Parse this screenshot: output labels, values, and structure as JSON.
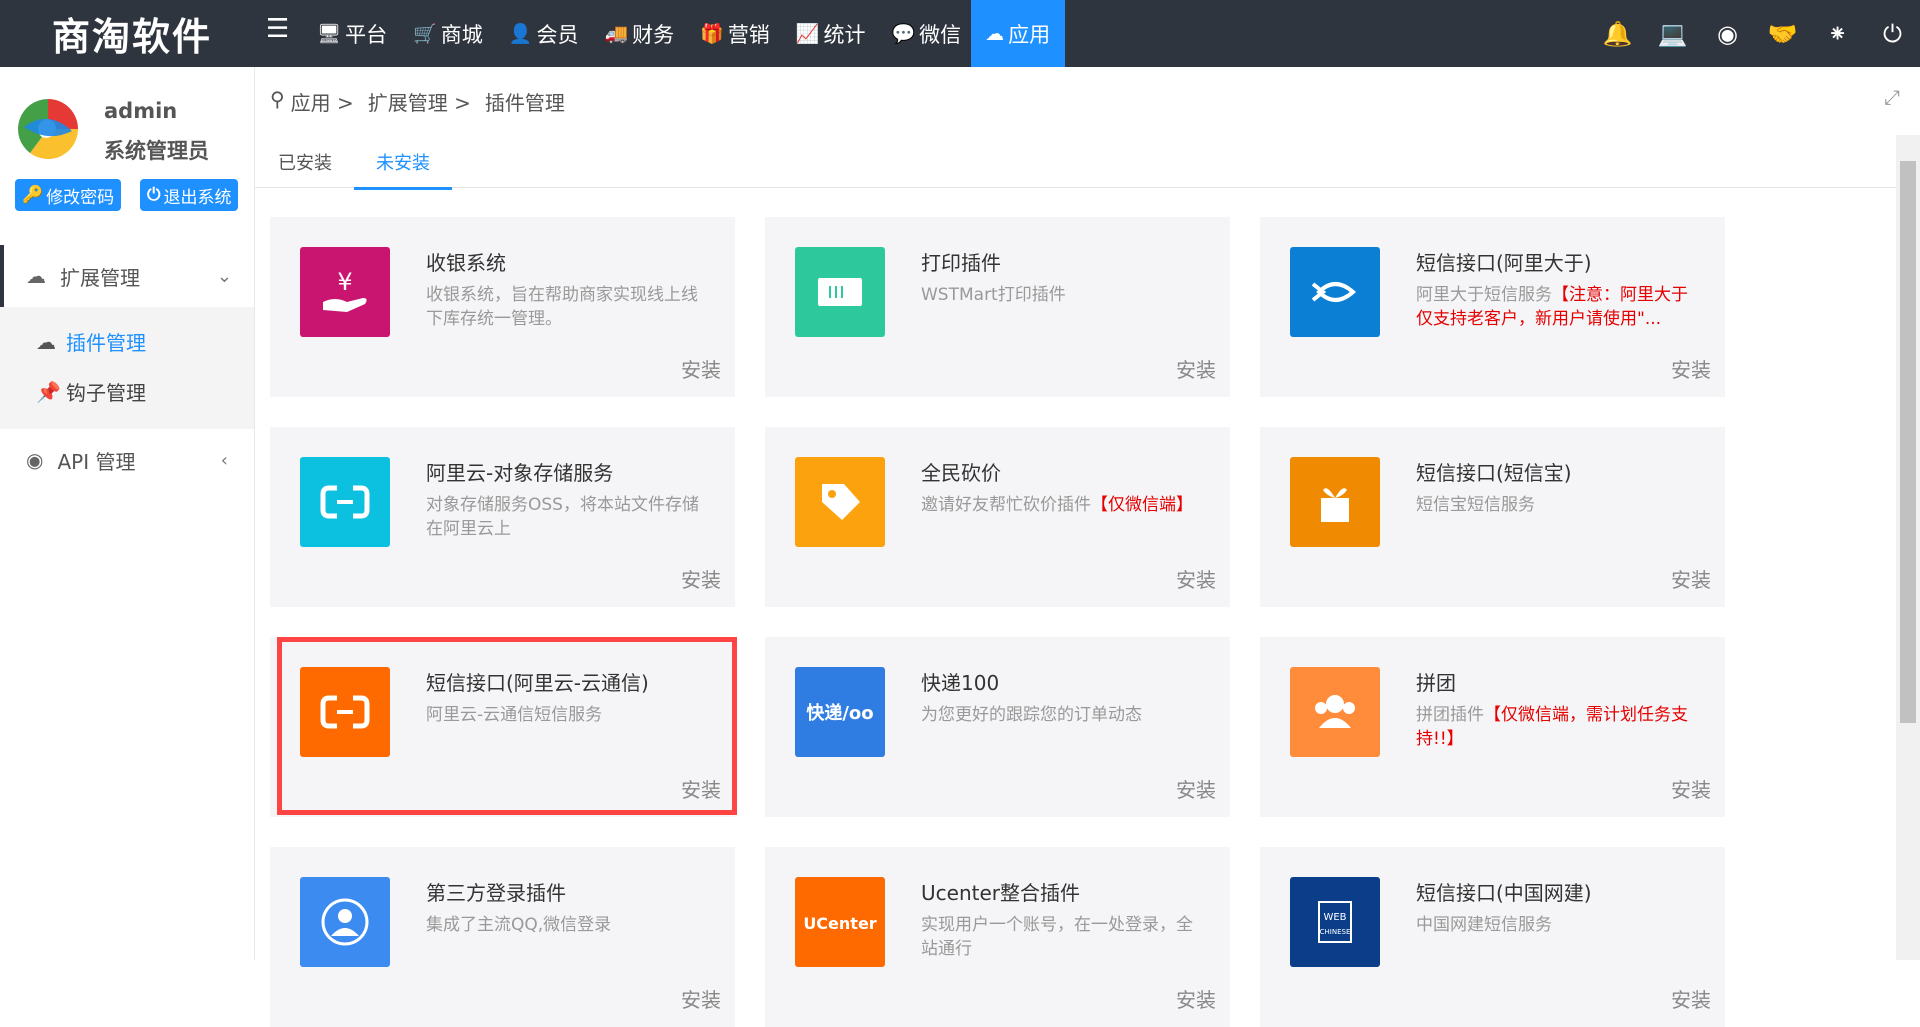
{
  "header": {
    "logo": "商淘软件",
    "nav": [
      {
        "label": "平台",
        "icon": "monitor-icon"
      },
      {
        "label": "商城",
        "icon": "cart-icon"
      },
      {
        "label": "会员",
        "icon": "user-icon"
      },
      {
        "label": "财务",
        "icon": "truck-icon"
      },
      {
        "label": "营销",
        "icon": "gift-icon"
      },
      {
        "label": "统计",
        "icon": "chart-icon"
      },
      {
        "label": "微信",
        "icon": "wechat-icon"
      },
      {
        "label": "应用",
        "icon": "cloud-icon",
        "active": true
      }
    ],
    "icons": [
      "bell-icon",
      "desktop-icon",
      "location-icon",
      "handshake-icon",
      "spinner-icon",
      "power-icon"
    ]
  },
  "user": {
    "name": "admin",
    "role": "系统管理员",
    "change_password": "修改密码",
    "logout": "退出系统"
  },
  "sidebar": {
    "group1": "扩展管理",
    "items": [
      "插件管理",
      "钩子管理"
    ],
    "group2": "API 管理"
  },
  "breadcrumb": [
    "应用 >",
    "扩展管理 >",
    "插件管理"
  ],
  "tabs": [
    "已安装",
    "未安装"
  ],
  "install_label": "安装",
  "plugins": [
    {
      "title": "收银系统",
      "desc": "收银系统，旨在帮助商家实现线上线下库存统一管理。",
      "red": "",
      "color": "#c9156f",
      "icon": "cashier-icon"
    },
    {
      "title": "打印插件",
      "desc": "WSTMart打印插件",
      "red": "",
      "color": "#2dc99c",
      "icon": "printer-icon"
    },
    {
      "title": "短信接口(阿里大于)",
      "desc": "阿里大于短信服务",
      "red": "【注意：阿里大于仅支持老客户，新用户请使用\"...",
      "color": "#0a7fd4",
      "icon": "fish-icon"
    },
    {
      "title": "阿里云-对象存储服务",
      "desc": "对象存储服务OSS，将本站文件存储在阿里云上",
      "red": "",
      "color": "#0cc0e0",
      "icon": "aliyun-icon"
    },
    {
      "title": "全民砍价",
      "desc": "邀请好友帮忙砍价插件",
      "red": "【仅微信端】",
      "color": "#fba20e",
      "icon": "tag-icon"
    },
    {
      "title": "短信接口(短信宝)",
      "desc": "短信宝短信服务",
      "red": "",
      "color": "#f08a00",
      "icon": "box-icon"
    },
    {
      "title": "短信接口(阿里云-云通信)",
      "desc": "阿里云-云通信短信服务",
      "red": "",
      "color": "#ff6a00",
      "icon": "aliyun-icon"
    },
    {
      "title": "快递100",
      "desc": "为您更好的跟踪您的订单动态",
      "red": "",
      "color": "#2f7de2",
      "icon": "kuaidi-icon"
    },
    {
      "title": "拼团",
      "desc": "拼团插件",
      "red": "【仅微信端，需计划任务支持!!】",
      "color": "#ff8c3a",
      "icon": "group-icon"
    },
    {
      "title": "第三方登录插件",
      "desc": "集成了主流QQ,微信登录",
      "red": "",
      "color": "#3b8bf0",
      "icon": "user-circle-icon"
    },
    {
      "title": "Ucenter整合插件",
      "desc": "实现用户一个账号，在一处登录，全站通行",
      "red": "",
      "color": "#ff6a00",
      "icon": "ucenter-icon"
    },
    {
      "title": "短信接口(中国网建)",
      "desc": "中国网建短信服务",
      "red": "",
      "color": "#0b3d88",
      "icon": "webchinese-icon"
    }
  ],
  "card_text": {
    "kuaidi": "快递/oo",
    "ucenter": "UCenter",
    "webchinese_1": "WEB",
    "webchinese_2": "CHINESE"
  }
}
